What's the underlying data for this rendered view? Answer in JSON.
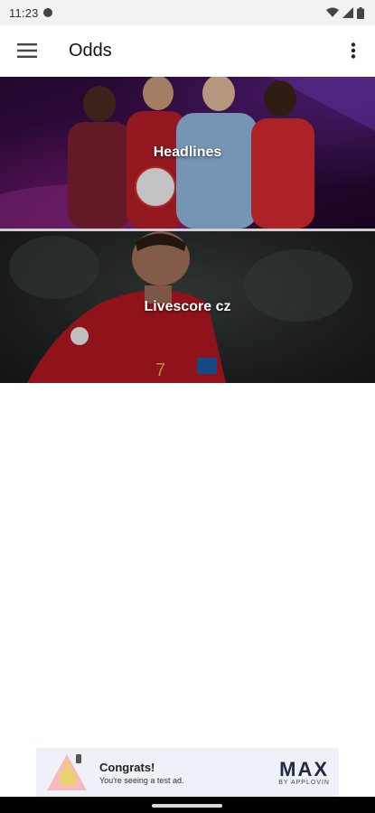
{
  "status_bar": {
    "time": "11:23",
    "icons": [
      "notification-icon",
      "wifi-icon",
      "signal-icon",
      "battery-icon"
    ]
  },
  "app_bar": {
    "title": "Odds",
    "left_icon": "hamburger-menu-icon",
    "right_icon": "more-vertical-icon"
  },
  "cards": [
    {
      "label": "Headlines"
    },
    {
      "label": "Livescore cz"
    }
  ],
  "ad": {
    "title": "Congrats!",
    "subtitle": "You're seeing a test ad.",
    "brand": "MAX",
    "brand_sub": "BY APPLOVIN"
  },
  "colors": {
    "card1_bg": "#3b0d4a",
    "card2_bg": "#252927",
    "ad_bg": "#eef1f7",
    "nav_bar": "#000000"
  }
}
